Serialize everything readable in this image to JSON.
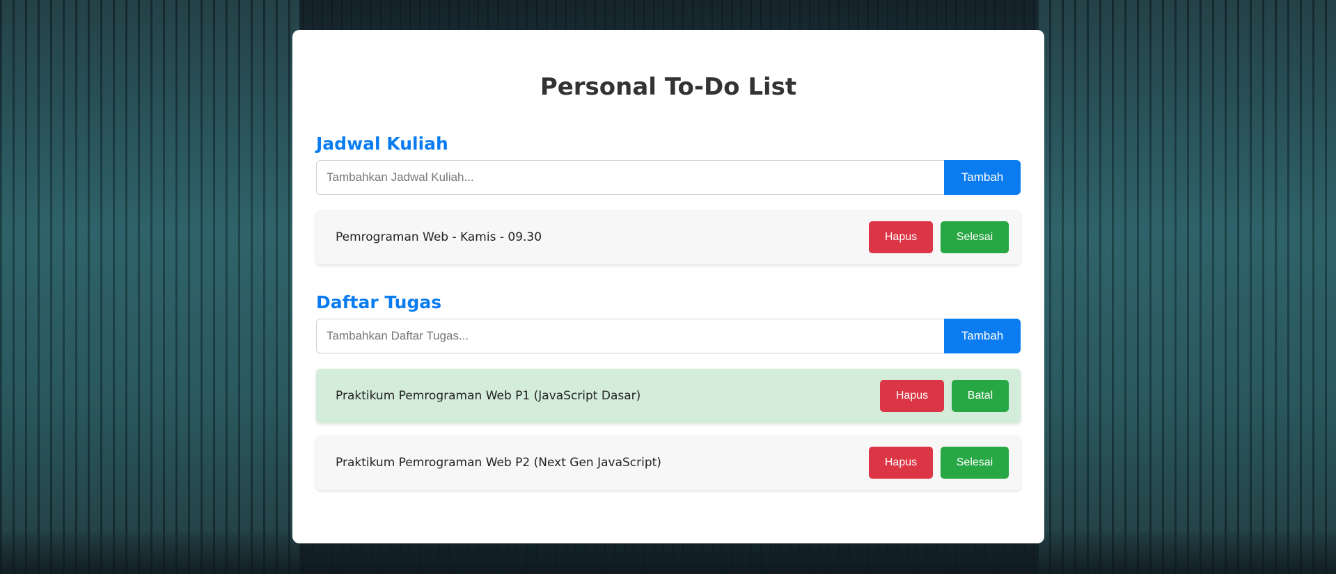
{
  "app": {
    "title": "Personal To-Do List"
  },
  "colors": {
    "accent": "#0a7cf0",
    "danger": "#dc3545",
    "success": "#28a745",
    "done_row": "#d4edda",
    "row": "#f7f7f7"
  },
  "sections": [
    {
      "title": "Jadwal Kuliah",
      "input_placeholder": "Tambahkan Jadwal Kuliah...",
      "input_value": "",
      "add_label": "Tambah",
      "items": [
        {
          "text": "Pemrograman Web - Kamis - 09.30",
          "done": false,
          "delete_label": "Hapus",
          "toggle_label": "Selesai"
        }
      ]
    },
    {
      "title": "Daftar Tugas",
      "input_placeholder": "Tambahkan Daftar Tugas...",
      "input_value": "",
      "add_label": "Tambah",
      "items": [
        {
          "text": "Praktikum Pemrograman Web P1 (JavaScript Dasar)",
          "done": true,
          "delete_label": "Hapus",
          "toggle_label": "Batal"
        },
        {
          "text": "Praktikum Pemrograman Web P2 (Next Gen JavaScript)",
          "done": false,
          "delete_label": "Hapus",
          "toggle_label": "Selesai"
        }
      ]
    }
  ]
}
